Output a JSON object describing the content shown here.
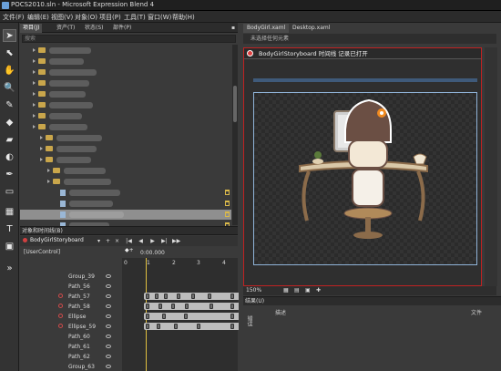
{
  "window": {
    "title": "POCS2010.sln - Microsoft Expression Blend 4"
  },
  "menu": [
    "文件(F)",
    "编辑(E)",
    "视图(V)",
    "对象(O)",
    "项目(P)",
    "工具(T)",
    "窗口(W)",
    "帮助(H)"
  ],
  "project_panel": {
    "tabs": [
      "项目(J)",
      "资产(T)",
      "状态(S)",
      "部件(P)"
    ],
    "search_placeholder": "搜索"
  },
  "objects_panel": {
    "title": "对象和时间线(B)",
    "storyboard": "BodyGirlStoryboard",
    "time": "0:00.000",
    "ruler": [
      "0",
      "1",
      "2",
      "3",
      "4"
    ],
    "root": "[UserControl]",
    "rows": [
      "Group_39",
      "Path_56",
      "Path_57",
      "Path_58",
      "Ellipse",
      "Ellipse_59",
      "Path_60",
      "Path_61",
      "Path_62",
      "Group_63"
    ]
  },
  "document": {
    "tabs": [
      "BodyGirl.xaml",
      "Desktop.xaml"
    ],
    "breadcrumb": "未选择任何元素",
    "recording": "BodyGirlStoryboard 时间线 记录已打开",
    "zoom": "150%"
  },
  "results_panel": {
    "title": "结果(U)",
    "col_desc": "描述",
    "col_file": "文件",
    "side_tab": "错误"
  },
  "colors": {
    "record": "#e04040",
    "accent": "#8fb3d8",
    "folder": "#c9a64b"
  }
}
